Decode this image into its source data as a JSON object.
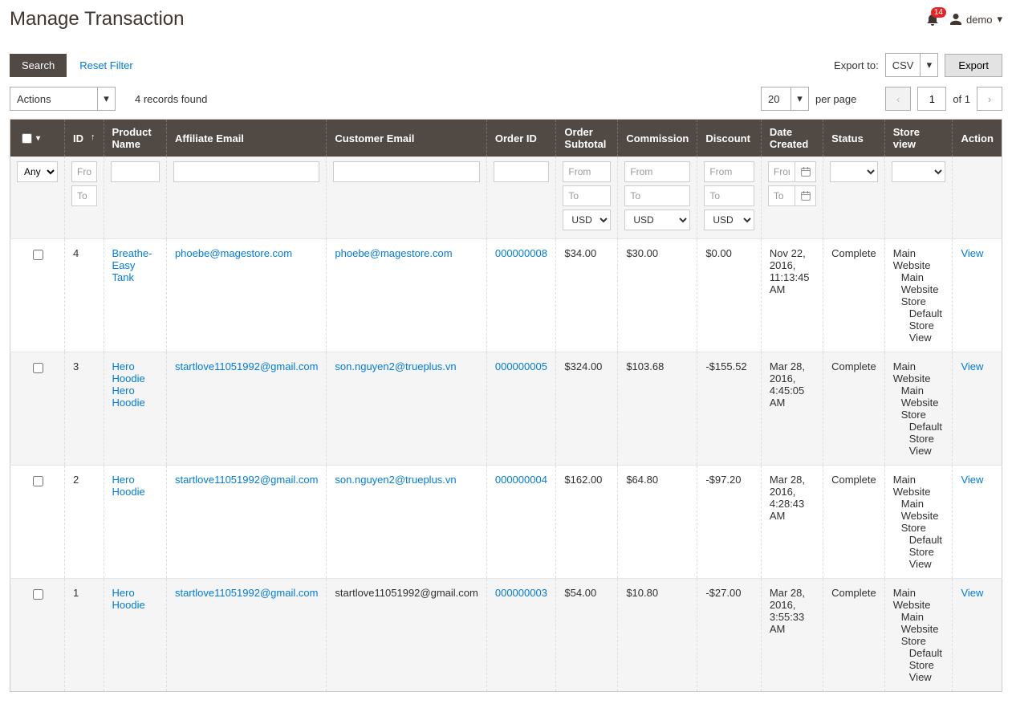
{
  "header": {
    "title": "Manage Transaction",
    "notif_count": "14",
    "user_label": "demo"
  },
  "toolbar": {
    "search_label": "Search",
    "reset_label": "Reset Filter",
    "export_to_label": "Export to:",
    "export_format": "CSV",
    "export_btn": "Export"
  },
  "row2": {
    "actions_label": "Actions",
    "records_found": "4 records found",
    "per_page_value": "20",
    "per_page_label": "per page",
    "page_value": "1",
    "page_total": "of 1"
  },
  "columns": {
    "id": "ID",
    "product": "Product Name",
    "aff_email": "Affiliate Email",
    "cust_email": "Customer Email",
    "order_id": "Order ID",
    "subtotal": "Order Subtotal",
    "commission": "Commission",
    "discount": "Discount",
    "date": "Date Created",
    "status": "Status",
    "store": "Store view",
    "action": "Action"
  },
  "filters": {
    "any": "Any",
    "from": "From",
    "to": "To",
    "usd": "USD"
  },
  "rows": [
    {
      "id": "4",
      "products": [
        "Breathe-Easy Tank"
      ],
      "aff_email": "phoebe@magestore.com",
      "cust_email": "phoebe@magestore.com",
      "cust_email_link": true,
      "order_id": "000000008",
      "subtotal": "$34.00",
      "commission": "$30.00",
      "discount": "$0.00",
      "date": "Nov 22, 2016, 11:13:45 AM",
      "status": "Complete",
      "action": "View"
    },
    {
      "id": "3",
      "products": [
        "Hero Hoodie",
        "Hero Hoodie"
      ],
      "aff_email": "startlove11051992@gmail.com",
      "cust_email": "son.nguyen2@trueplus.vn",
      "cust_email_link": true,
      "order_id": "000000005",
      "subtotal": "$324.00",
      "commission": "$103.68",
      "discount": "-$155.52",
      "date": "Mar 28, 2016, 4:45:05 AM",
      "status": "Complete",
      "action": "View"
    },
    {
      "id": "2",
      "products": [
        "Hero Hoodie"
      ],
      "aff_email": "startlove11051992@gmail.com",
      "cust_email": "son.nguyen2@trueplus.vn",
      "cust_email_link": true,
      "order_id": "000000004",
      "subtotal": "$162.00",
      "commission": "$64.80",
      "discount": "-$97.20",
      "date": "Mar 28, 2016, 4:28:43 AM",
      "status": "Complete",
      "action": "View"
    },
    {
      "id": "1",
      "products": [
        "Hero Hoodie"
      ],
      "aff_email": "startlove11051992@gmail.com",
      "cust_email": "startlove11051992@gmail.com",
      "cust_email_link": false,
      "order_id": "000000003",
      "subtotal": "$54.00",
      "commission": "$10.80",
      "discount": "-$27.00",
      "date": "Mar 28, 2016, 3:55:33 AM",
      "status": "Complete",
      "action": "View"
    }
  ],
  "store_view": {
    "l1": "Main Website",
    "l2": "Main Website Store",
    "l3": "Default Store View"
  }
}
